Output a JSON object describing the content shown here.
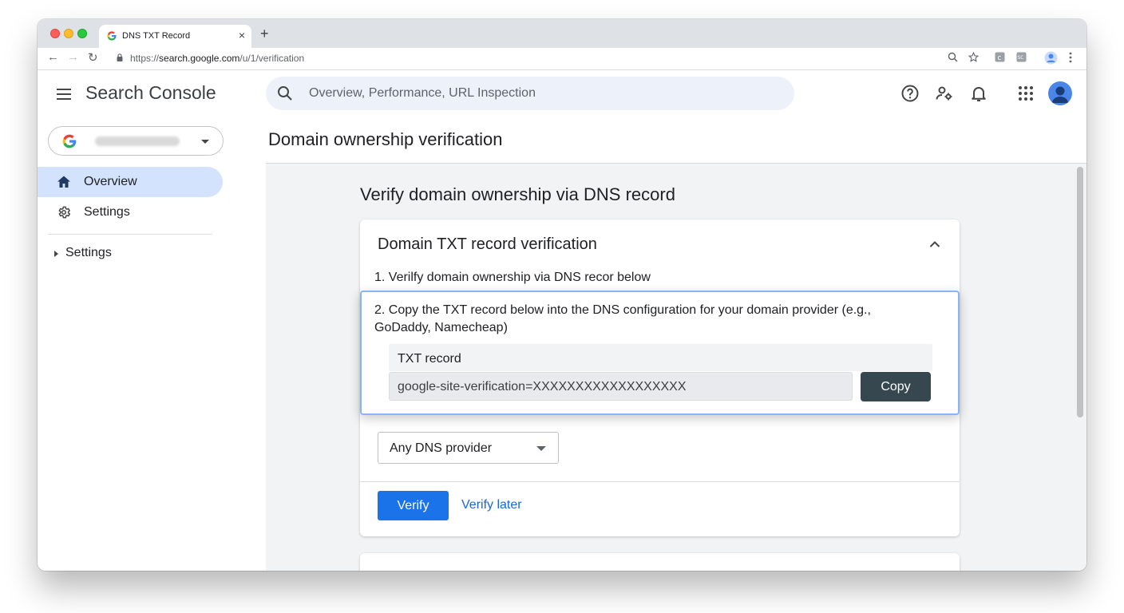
{
  "browser": {
    "tab_title": "DNS TXT Record",
    "tab_close": "×",
    "new_tab": "+",
    "url_prefix": "https://",
    "url_host": "search.google.com",
    "url_path": "/u/1/verification",
    "nav": {
      "back": "←",
      "forward": "→",
      "reload": "↻"
    }
  },
  "app": {
    "title": "Search Console",
    "search_placeholder": "Overview, Performance, URL Inspection"
  },
  "sidebar": {
    "items": [
      {
        "label": "Overview",
        "icon": "home-icon",
        "active": true
      },
      {
        "label": "Settings",
        "icon": "gear-icon",
        "active": false
      }
    ],
    "collapsed_section": "Settings"
  },
  "page": {
    "title": "Domain ownership verification",
    "section_title": "Verify domain ownership via DNS record",
    "card": {
      "title": "Domain TXT record verification",
      "step1": "1. Verilfy domain ownership via DNS recor below",
      "step2": "2. Copy the TXT record below into the DNS configuration for your domain provider (e.g., GoDaddy, Namecheap)",
      "record_label": "TXT record",
      "record_value": "google-site-verification=XXXXXXXXXXXXXXXXXX",
      "copy_label": "Copy",
      "dns_provider": "Any DNS provider",
      "verify_label": "Verify",
      "verify_later_label": "Verify later"
    }
  },
  "colors": {
    "accent": "#1a73e8",
    "nav_active": "#d3e3fd",
    "copy_button": "#37474f",
    "highlight_border": "#8ab4f8"
  }
}
